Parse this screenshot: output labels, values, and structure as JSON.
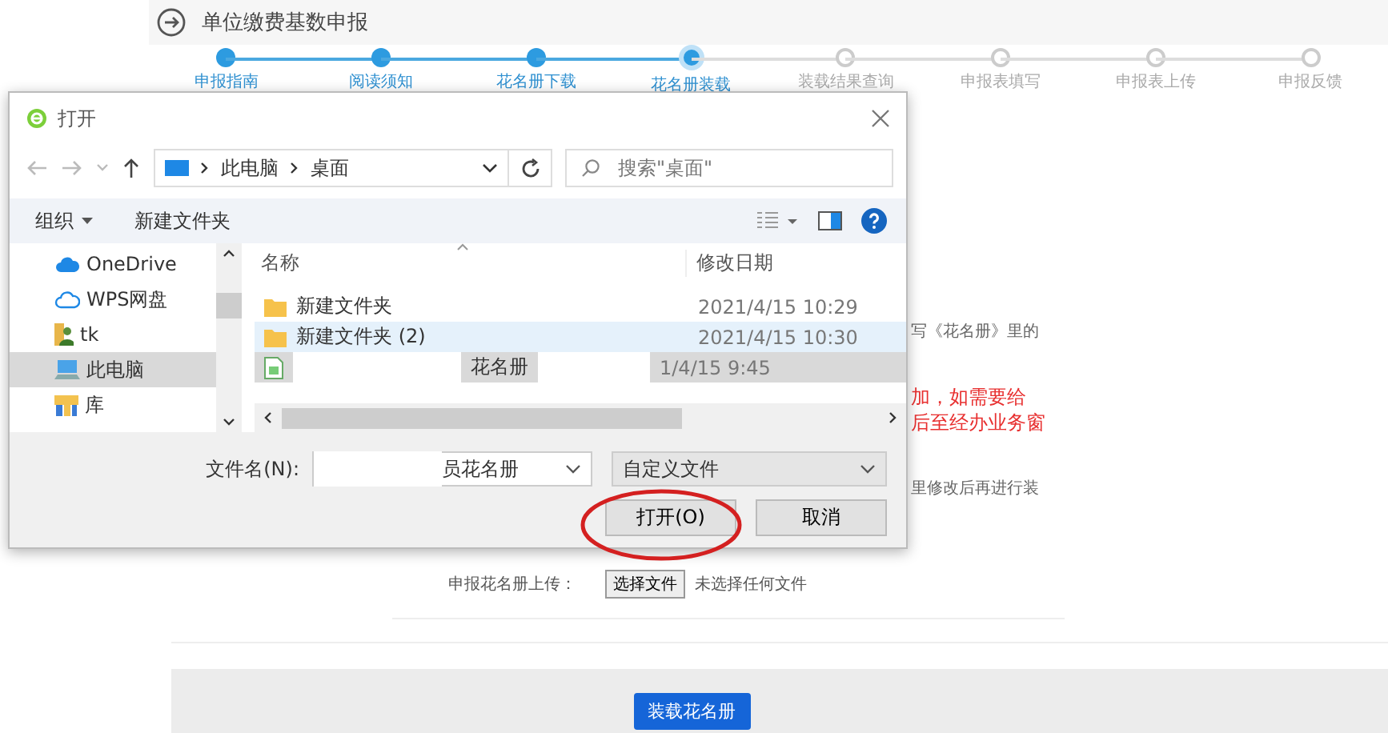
{
  "page": {
    "title": "单位缴费基数申报",
    "steps": [
      {
        "label": "申报指南",
        "completed": true,
        "current": false
      },
      {
        "label": "阅读须知",
        "completed": true,
        "current": false
      },
      {
        "label": "花名册下载",
        "completed": true,
        "current": false
      },
      {
        "label": "花名册装载",
        "completed": true,
        "current": true
      },
      {
        "label": "装载结果查询",
        "completed": false,
        "current": false
      },
      {
        "label": "申报表填写",
        "completed": false,
        "current": false
      },
      {
        "label": "申报表上传",
        "completed": false,
        "current": false
      },
      {
        "label": "申报反馈",
        "completed": false,
        "current": false
      }
    ],
    "notes": [
      {
        "text": "写《花名册》里的",
        "kind": "normal"
      },
      {
        "text": "加，如需要给",
        "kind": "warning"
      },
      {
        "text": "后至经办业务窗",
        "kind": "warning"
      },
      {
        "text": "里修改后再进行装",
        "kind": "normal"
      }
    ],
    "upload": {
      "label": "申报花名册上传：",
      "button": "选择文件",
      "status": "未选择任何文件"
    },
    "submit_button": "装载花名册"
  },
  "dialog": {
    "title": "打开",
    "address": [
      "此电脑",
      "桌面"
    ],
    "search": {
      "placeholder": "搜索\"桌面\""
    },
    "toolbar": [
      "组织",
      "新建文件夹"
    ],
    "nav_items": [
      {
        "label": "OneDrive",
        "kind": "cloud",
        "selected": false
      },
      {
        "label": "WPS网盘",
        "kind": "cloud-outline",
        "selected": false
      },
      {
        "label": "tk",
        "kind": "user",
        "selected": false
      },
      {
        "label": "此电脑",
        "kind": "computer",
        "selected": true
      },
      {
        "label": "库",
        "kind": "library",
        "selected": false
      }
    ],
    "columns": [
      "名称",
      "修改日期"
    ],
    "files": [
      {
        "name": "新建文件夹",
        "date": "2021/4/15 10:29",
        "kind": "folder",
        "selected": false,
        "hovered": false
      },
      {
        "name": "新建文件夹 (2)",
        "date": "2021/4/15 10:30",
        "kind": "folder",
        "selected": false,
        "hovered": true
      },
      {
        "name": "花名册",
        "date": "1/4/15 9:45",
        "kind": "sheet",
        "selected": true,
        "hovered": false
      }
    ],
    "file_name": {
      "label": "文件名(N):",
      "value": "员花名册"
    },
    "file_type": "自定义文件",
    "buttons": [
      "打开(O)",
      "取消"
    ]
  }
}
